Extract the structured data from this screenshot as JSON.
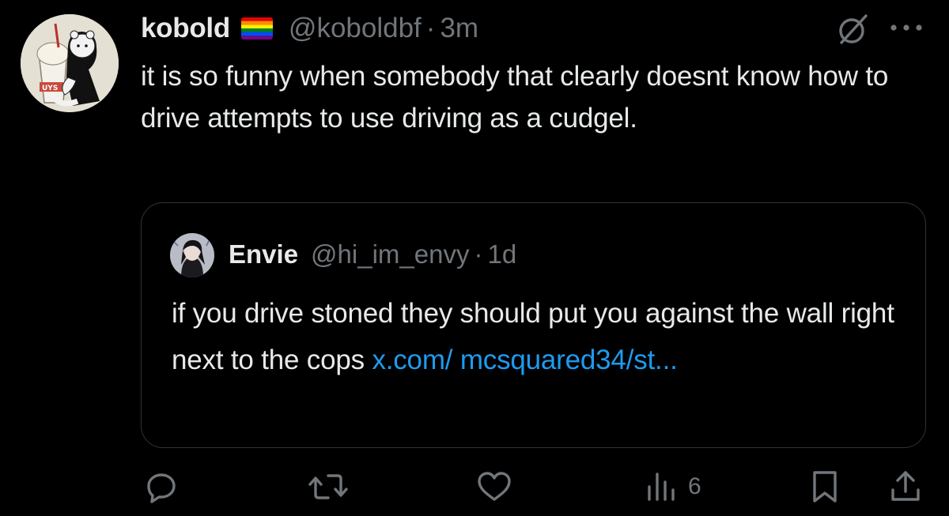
{
  "tweet": {
    "display_name": "kobold",
    "handle": "@koboldbf",
    "separator": "·",
    "time": "3m",
    "text": "it is so funny when somebody that clearly doesnt know how to drive attempts to use driving as a cudgel.",
    "flag_icon": "rainbow-flag-emoji",
    "header_icons": [
      "grok-icon",
      "more-icon"
    ]
  },
  "quote": {
    "display_name": "Envie",
    "handle": "@hi_im_envy",
    "separator": "·",
    "time": "1d",
    "text": "if you drive stoned they should put you against the wall right next to the cops ",
    "link_text": "x.com/ mcsquared34/st..."
  },
  "actions": {
    "reply_icon": "reply-icon",
    "retweet_icon": "retweet-icon",
    "like_icon": "heart-icon",
    "views_icon": "analytics-icon",
    "views_count": "6",
    "bookmark_icon": "bookmark-icon",
    "share_icon": "share-icon"
  },
  "colors": {
    "background": "#000000",
    "text": "#e7e9ea",
    "muted": "#71767b",
    "link": "#1d9bf0",
    "border": "#2f3336"
  }
}
